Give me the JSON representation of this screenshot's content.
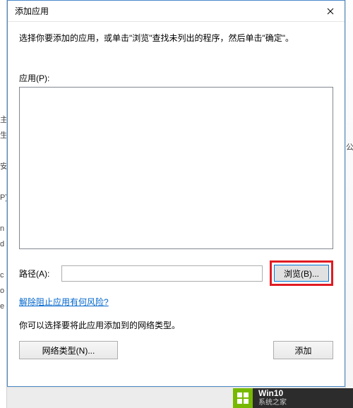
{
  "dialog": {
    "title": "添加应用",
    "instruction": "选择你要添加的应用，或单击\"浏览\"查找未列出的程序，然后单击\"确定\"。",
    "list_label": "应用(P):",
    "path_label": "路径(A):",
    "path_value": "",
    "browse_label": "浏览(B)...",
    "risk_link": "解除阻止应用有何风险?",
    "network_instruction": "你可以选择要将此应用添加到的网络类型。",
    "net_type_label": "网络类型(N)...",
    "add_label": "添加"
  },
  "left_artifact": {
    "chars": [
      "主",
      "生",
      "",
      "安",
      "",
      "P)",
      "",
      "n",
      "d",
      "",
      "c",
      "o",
      "e",
      ""
    ]
  },
  "right_artifact": {
    "char": "公"
  },
  "watermark": {
    "line1": "Win10",
    "line2": "系统之家"
  }
}
